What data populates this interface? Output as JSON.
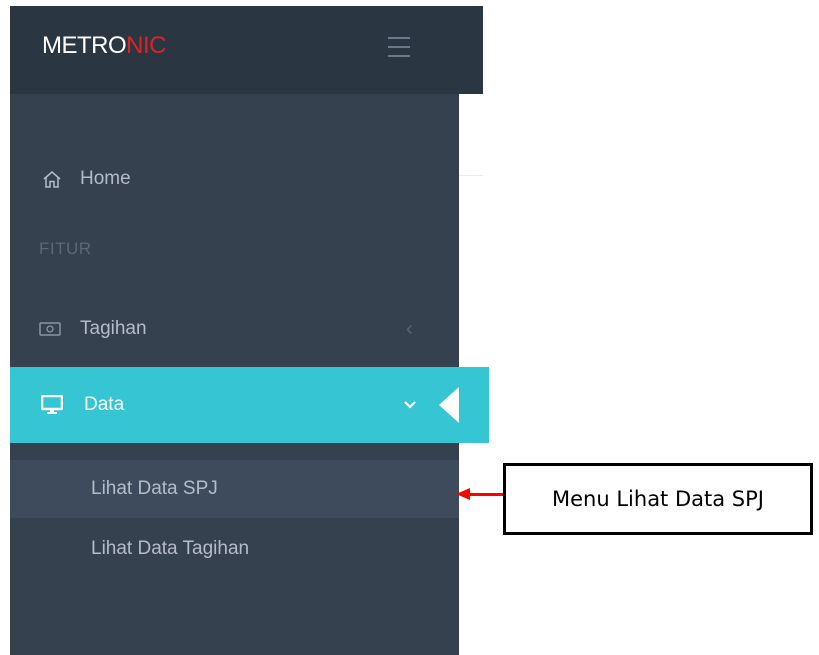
{
  "header": {
    "logo_part1": "METRO",
    "logo_part2": "NIC",
    "menu_toggle_icon": "hamburger-icon"
  },
  "sidebar": {
    "home": {
      "label": "Home",
      "icon": "home-icon"
    },
    "section_heading": "FITUR",
    "tagihan": {
      "label": "Tagihan",
      "icon": "money-icon",
      "arrow": "‹"
    },
    "data": {
      "label": "Data",
      "icon": "monitor-icon",
      "expanded": true
    },
    "submenu": [
      {
        "label": "Lihat Data SPJ",
        "active": true
      },
      {
        "label": "Lihat Data Tagihan",
        "active": false
      }
    ]
  },
  "annotation": {
    "text": "Menu Lihat Data SPJ"
  },
  "colors": {
    "topbar": "#2b3643",
    "sidebar": "#364150",
    "active_item": "#36c6d3",
    "submenu_active": "#3e4b5c",
    "logo_accent": "#e02222",
    "annotation_arrow": "#ff0000"
  }
}
